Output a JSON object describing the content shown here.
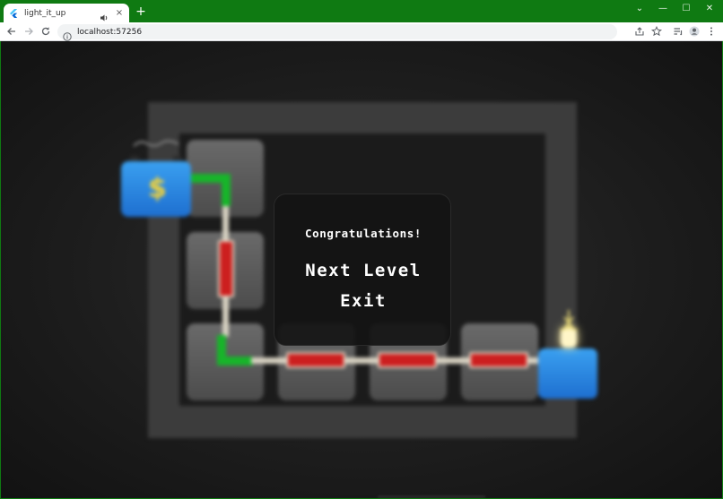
{
  "browser": {
    "tab_title": "light_it_up",
    "url": "localhost:57256",
    "new_tab_label": "+",
    "close_tab_label": "×",
    "window_controls": {
      "minimize": "—",
      "maximize": "☐",
      "close": "✕",
      "tab_search": "⌄"
    }
  },
  "dialog": {
    "message": "Congratulations!",
    "next_level_label": "Next Level",
    "exit_label": "Exit"
  },
  "colors": {
    "chrome_green": "#0f7a12",
    "wire_red": "#cc1f1f",
    "wire_green": "#17b52a",
    "battery_blue": "#2e88e4",
    "bulb_glow": "#fff0a0"
  },
  "icons": {
    "favicon": "flutter-icon",
    "audio": "speaker-icon",
    "back": "arrow-left-icon",
    "forward": "arrow-right-icon",
    "reload": "reload-icon",
    "site_info": "info-icon",
    "share": "share-icon",
    "bookmark": "star-icon",
    "reading_list": "reading-list-icon",
    "profile": "profile-icon",
    "menu": "kebab-menu-icon"
  }
}
